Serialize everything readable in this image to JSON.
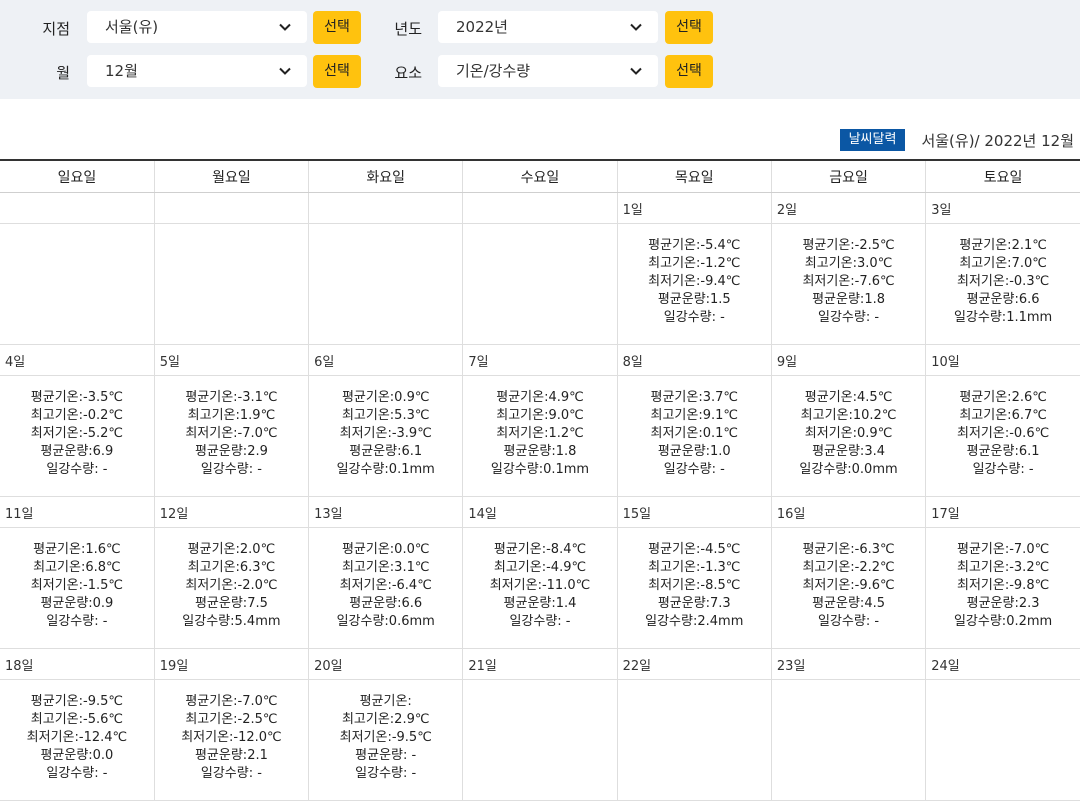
{
  "filters": {
    "station_label": "지점",
    "station_value": "서울(유)",
    "year_label": "년도",
    "year_value": "2022년",
    "month_label": "월",
    "month_value": "12월",
    "element_label": "요소",
    "element_value": "기온/강수량",
    "select_button": "선택"
  },
  "calendar": {
    "badge": "날씨달력",
    "title": "서울(유)/ 2022년 12월",
    "weekdays": [
      "일요일",
      "월요일",
      "화요일",
      "수요일",
      "목요일",
      "금요일",
      "토요일"
    ],
    "weeks": [
      {
        "dates": [
          "",
          "",
          "",
          "",
          "1일",
          "2일",
          "3일"
        ],
        "cells": [
          [],
          [],
          [],
          [],
          [
            "평균기온:-5.4℃",
            "최고기온:-1.2℃",
            "최저기온:-9.4℃",
            "평균운량:1.5",
            "일강수량: -"
          ],
          [
            "평균기온:-2.5℃",
            "최고기온:3.0℃",
            "최저기온:-7.6℃",
            "평균운량:1.8",
            "일강수량: -"
          ],
          [
            "평균기온:2.1℃",
            "최고기온:7.0℃",
            "최저기온:-0.3℃",
            "평균운량:6.6",
            "일강수량:1.1mm"
          ]
        ]
      },
      {
        "dates": [
          "4일",
          "5일",
          "6일",
          "7일",
          "8일",
          "9일",
          "10일"
        ],
        "cells": [
          [
            "평균기온:-3.5℃",
            "최고기온:-0.2℃",
            "최저기온:-5.2℃",
            "평균운량:6.9",
            "일강수량: -"
          ],
          [
            "평균기온:-3.1℃",
            "최고기온:1.9℃",
            "최저기온:-7.0℃",
            "평균운량:2.9",
            "일강수량: -"
          ],
          [
            "평균기온:0.9℃",
            "최고기온:5.3℃",
            "최저기온:-3.9℃",
            "평균운량:6.1",
            "일강수량:0.1mm"
          ],
          [
            "평균기온:4.9℃",
            "최고기온:9.0℃",
            "최저기온:1.2℃",
            "평균운량:1.8",
            "일강수량:0.1mm"
          ],
          [
            "평균기온:3.7℃",
            "최고기온:9.1℃",
            "최저기온:0.1℃",
            "평균운량:1.0",
            "일강수량: -"
          ],
          [
            "평균기온:4.5℃",
            "최고기온:10.2℃",
            "최저기온:0.9℃",
            "평균운량:3.4",
            "일강수량:0.0mm"
          ],
          [
            "평균기온:2.6℃",
            "최고기온:6.7℃",
            "최저기온:-0.6℃",
            "평균운량:6.1",
            "일강수량: -"
          ]
        ]
      },
      {
        "dates": [
          "11일",
          "12일",
          "13일",
          "14일",
          "15일",
          "16일",
          "17일"
        ],
        "cells": [
          [
            "평균기온:1.6℃",
            "최고기온:6.8℃",
            "최저기온:-1.5℃",
            "평균운량:0.9",
            "일강수량: -"
          ],
          [
            "평균기온:2.0℃",
            "최고기온:6.3℃",
            "최저기온:-2.0℃",
            "평균운량:7.5",
            "일강수량:5.4mm"
          ],
          [
            "평균기온:0.0℃",
            "최고기온:3.1℃",
            "최저기온:-6.4℃",
            "평균운량:6.6",
            "일강수량:0.6mm"
          ],
          [
            "평균기온:-8.4℃",
            "최고기온:-4.9℃",
            "최저기온:-11.0℃",
            "평균운량:1.4",
            "일강수량: -"
          ],
          [
            "평균기온:-4.5℃",
            "최고기온:-1.3℃",
            "최저기온:-8.5℃",
            "평균운량:7.3",
            "일강수량:2.4mm"
          ],
          [
            "평균기온:-6.3℃",
            "최고기온:-2.2℃",
            "최저기온:-9.6℃",
            "평균운량:4.5",
            "일강수량: -"
          ],
          [
            "평균기온:-7.0℃",
            "최고기온:-3.2℃",
            "최저기온:-9.8℃",
            "평균운량:2.3",
            "일강수량:0.2mm"
          ]
        ]
      },
      {
        "dates": [
          "18일",
          "19일",
          "20일",
          "21일",
          "22일",
          "23일",
          "24일"
        ],
        "cells": [
          [
            "평균기온:-9.5℃",
            "최고기온:-5.6℃",
            "최저기온:-12.4℃",
            "평균운량:0.0",
            "일강수량: -"
          ],
          [
            "평균기온:-7.0℃",
            "최고기온:-2.5℃",
            "최저기온:-12.0℃",
            "평균운량:2.1",
            "일강수량: -"
          ],
          [
            "평균기온:",
            "최고기온:2.9℃",
            "최저기온:-9.5℃",
            "평균운량: -",
            "일강수량: -"
          ],
          [],
          [],
          [],
          []
        ]
      }
    ]
  }
}
